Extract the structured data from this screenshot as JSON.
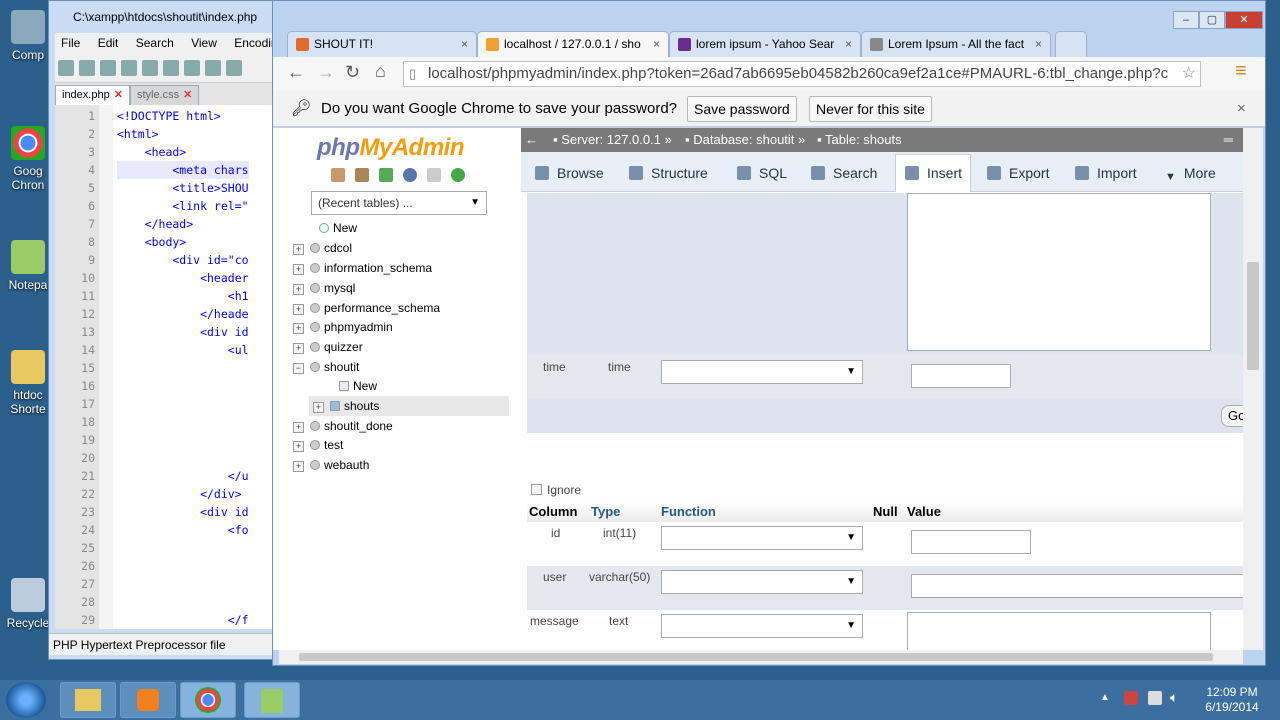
{
  "desktop": {
    "icons": [
      {
        "label": "Comp",
        "icon": "computer-icon"
      },
      {
        "label": "Goog",
        "label2": "Chron",
        "icon": "chrome-icon"
      },
      {
        "label": "Notepa",
        "icon": "notepad-icon"
      },
      {
        "label": "htdoc",
        "label2": "Shorte",
        "icon": "folder-icon"
      },
      {
        "label": "Recycle",
        "icon": "recycle-bin-icon"
      }
    ]
  },
  "notepad": {
    "title": "C:\\xampp\\htdocs\\shoutit\\index.php",
    "menu": [
      "File",
      "Edit",
      "Search",
      "View",
      "Encoding"
    ],
    "tabs": [
      {
        "label": "index.php",
        "active": true
      },
      {
        "label": "style.css",
        "active": false
      }
    ],
    "line_numbers": [
      "1",
      "2",
      "3",
      "4",
      "5",
      "6",
      "7",
      "8",
      "9",
      "10",
      "11",
      "12",
      "13",
      "14",
      "15",
      "16",
      "17",
      "18",
      "19",
      "20",
      "21",
      "22",
      "23",
      "24",
      "25",
      "26",
      "27",
      "28",
      "29"
    ],
    "lines": [
      "<!DOCTYPE html>",
      "<html>",
      "    <head>",
      "        <meta chars",
      "        <title>SHOU",
      "        <link rel=\"",
      "    </head>",
      "    <body>",
      "        <div id=\"co",
      "            <header",
      "                <h1",
      "            </heade",
      "            <div id",
      "                <ul",
      "",
      "",
      "",
      "",
      "",
      "",
      "                </u",
      "            </div>",
      "            <div id",
      "                <fo",
      "",
      "",
      "",
      "",
      "                </f"
    ],
    "status": "PHP Hypertext Preprocessor file"
  },
  "browser": {
    "tabs": [
      {
        "label": "SHOUT IT!",
        "color": "#e06b2b"
      },
      {
        "label": "localhost / 127.0.0.1 / sho",
        "color": "#f0a030"
      },
      {
        "label": "lorem ipsum - Yahoo Sear",
        "color": "#6b2c91"
      },
      {
        "label": "Lorem Ipsum - All the fact",
        "color": "#888888"
      }
    ],
    "url": "localhost/phpmyadmin/index.php?token=26ad7ab6695eb04582b260ca9ef2a1ce#PMAURL-6:tbl_change.php?c",
    "password_bar": {
      "message": "Do you want Google Chrome to save your password?",
      "save": "Save password",
      "never": "Never for this site"
    }
  },
  "pma": {
    "logo_php": "php",
    "logo_my": "MyAdmin",
    "recent": "(Recent tables) ...",
    "tree": {
      "new": "New",
      "databases": [
        "cdcol",
        "information_schema",
        "mysql",
        "performance_schema",
        "phpmyadmin",
        "quizzer"
      ],
      "shoutit": "shoutit",
      "shoutit_children": [
        "New",
        "shouts"
      ],
      "after": [
        "shoutit_done",
        "test",
        "webauth"
      ]
    },
    "breadcrumb": {
      "server": "Server: 127.0.0.1",
      "database": "Database: shoutit",
      "table": "Table: shouts"
    },
    "tabs": [
      "Browse",
      "Structure",
      "SQL",
      "Search",
      "Insert",
      "Export",
      "Import",
      "More"
    ],
    "time_row": {
      "column": "time",
      "type": "time"
    },
    "go": "Go",
    "ignore": "Ignore",
    "headers": [
      "Column",
      "Type",
      "Function",
      "Null",
      "Value"
    ],
    "rows": [
      {
        "column": "id",
        "type": "int(11)"
      },
      {
        "column": "user",
        "type": "varchar(50)"
      },
      {
        "column": "message",
        "type": "text"
      }
    ]
  },
  "taskbar": {
    "time": "12:09 PM",
    "date": "6/19/2014"
  },
  "colors": {
    "pma_tab_bar": "#e8eef6",
    "pma_breadcrumb": "#7a7a7a",
    "desktop": "#2b5f8c"
  }
}
